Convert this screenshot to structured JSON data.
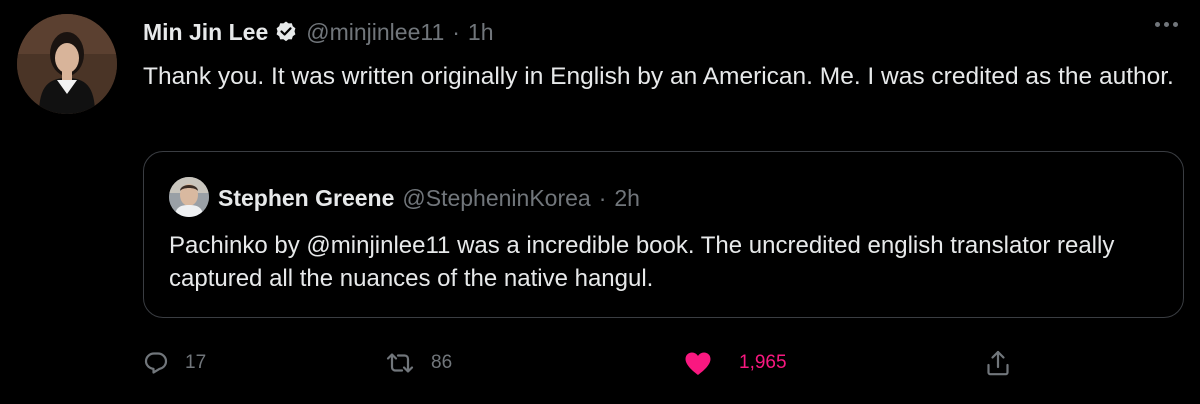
{
  "tweet": {
    "author": {
      "name": "Min Jin Lee",
      "handle": "@minjinlee11",
      "time": "1h",
      "verified": true
    },
    "text": "Thank you. It was written originally in English by an American. Me. I was credited as the author.",
    "separator": "·"
  },
  "quote": {
    "author": {
      "name": "Stephen Greene",
      "handle": "@StepheninKorea",
      "time": "2h"
    },
    "text": "Pachinko by @minjinlee11 was a incredible book. The uncredited english translator really captured all the nuances of the native hangul.",
    "separator": "·"
  },
  "actions": {
    "reply_count": "17",
    "retweet_count": "86",
    "like_count": "1,965",
    "liked": true
  },
  "colors": {
    "background": "#000000",
    "text": "#e7e9ea",
    "muted": "#71767b",
    "like": "#f91880",
    "border": "#3a3d42"
  },
  "icons": {
    "avatar": "avatar-min-jin-lee",
    "verified": "verified-badge-icon",
    "more": "more-icon",
    "quote_avatar": "avatar-stephen-greene",
    "reply": "reply-icon",
    "retweet": "retweet-icon",
    "like": "heart-icon",
    "share": "share-icon"
  }
}
